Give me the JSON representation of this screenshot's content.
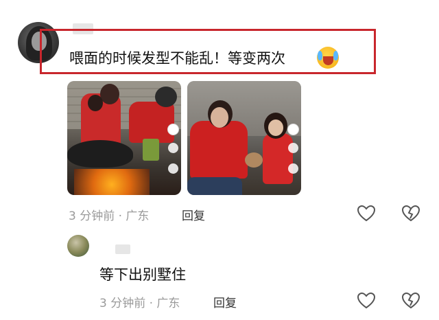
{
  "comment": {
    "text": "喂面的时候发型不能乱！等变两次",
    "emoji": "crying-laughing-emoji",
    "meta": "3 分钟前 · 广东",
    "reply_label": "回复",
    "photos": [
      {
        "icon": "photo-cooking-wok"
      },
      {
        "icon": "photo-feeding-child"
      }
    ]
  },
  "reply": {
    "text": "等下出别墅住",
    "meta": "3 分钟前 · 广东",
    "reply_label": "回复"
  },
  "colors": {
    "highlight": "#c8262c",
    "meta": "#9a9a9a"
  }
}
